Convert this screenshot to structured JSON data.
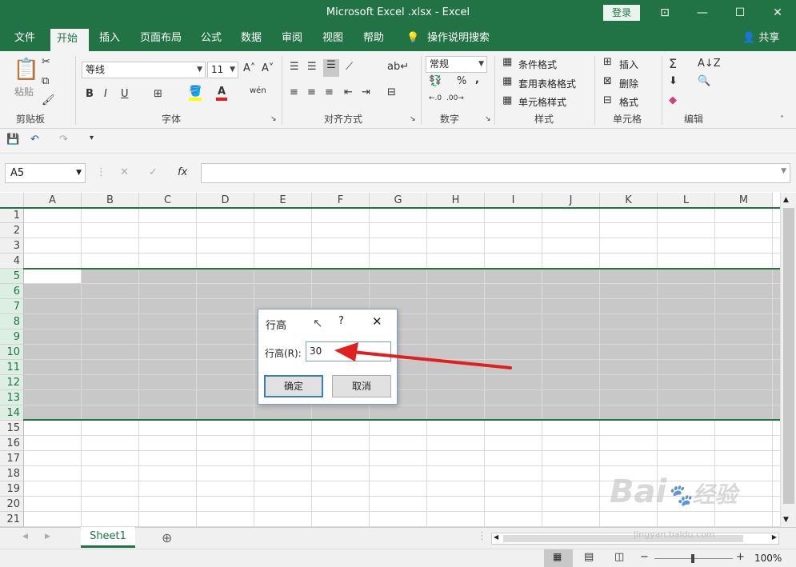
{
  "window": {
    "title": "Microsoft Excel .xlsx  -  Excel",
    "login": "登录"
  },
  "ribbon_tabs": [
    {
      "label": "文件"
    },
    {
      "label": "开始"
    },
    {
      "label": "插入"
    },
    {
      "label": "页面布局"
    },
    {
      "label": "公式"
    },
    {
      "label": "数据"
    },
    {
      "label": "审阅"
    },
    {
      "label": "视图"
    },
    {
      "label": "帮助"
    },
    {
      "label": "操作说明搜索"
    }
  ],
  "share": "共享",
  "clipboard": {
    "paste": "粘贴",
    "label": "剪贴板"
  },
  "font": {
    "name": "等线",
    "size": "11",
    "label": "字体",
    "bold": "B",
    "italic": "I",
    "underline": "U",
    "font_color": "A",
    "wen": "wén"
  },
  "alignment": {
    "label": "对齐方式"
  },
  "number": {
    "format": "常规",
    "percent": "%",
    "comma": ",",
    "label": "数字"
  },
  "styles": {
    "conditional": "条件格式",
    "table": "套用表格格式",
    "cell": "单元格样式",
    "label": "样式"
  },
  "cells": {
    "insert": "插入",
    "delete": "删除",
    "format": "格式",
    "label": "单元格"
  },
  "editing": {
    "label": "编辑"
  },
  "formula_bar": {
    "name_box": "A5",
    "fx": "fx"
  },
  "columns": [
    "A",
    "B",
    "C",
    "D",
    "E",
    "F",
    "G",
    "H",
    "I",
    "J",
    "K",
    "L",
    "M"
  ],
  "rows": [
    "1",
    "2",
    "3",
    "4",
    "5",
    "6",
    "7",
    "8",
    "9",
    "10",
    "11",
    "12",
    "13",
    "14",
    "15",
    "16",
    "17",
    "18",
    "19",
    "20",
    "21"
  ],
  "selected_rows": [
    "5",
    "6",
    "7",
    "8",
    "9",
    "10",
    "11",
    "12",
    "13",
    "14"
  ],
  "sheets": [
    {
      "name": "Sheet1"
    }
  ],
  "status": {
    "zoom": "100%"
  },
  "dialog": {
    "title": "行高",
    "help": "?",
    "field_label": "行高(R):",
    "field_value": "30",
    "ok": "确定",
    "cancel": "取消"
  },
  "watermark": {
    "line1": "Bai",
    "line2": "经验",
    "url": "jingyan.baidu.com"
  },
  "colors": {
    "brand": "#217346",
    "selection": "#c8c8c8",
    "arrow": "#e02020"
  }
}
